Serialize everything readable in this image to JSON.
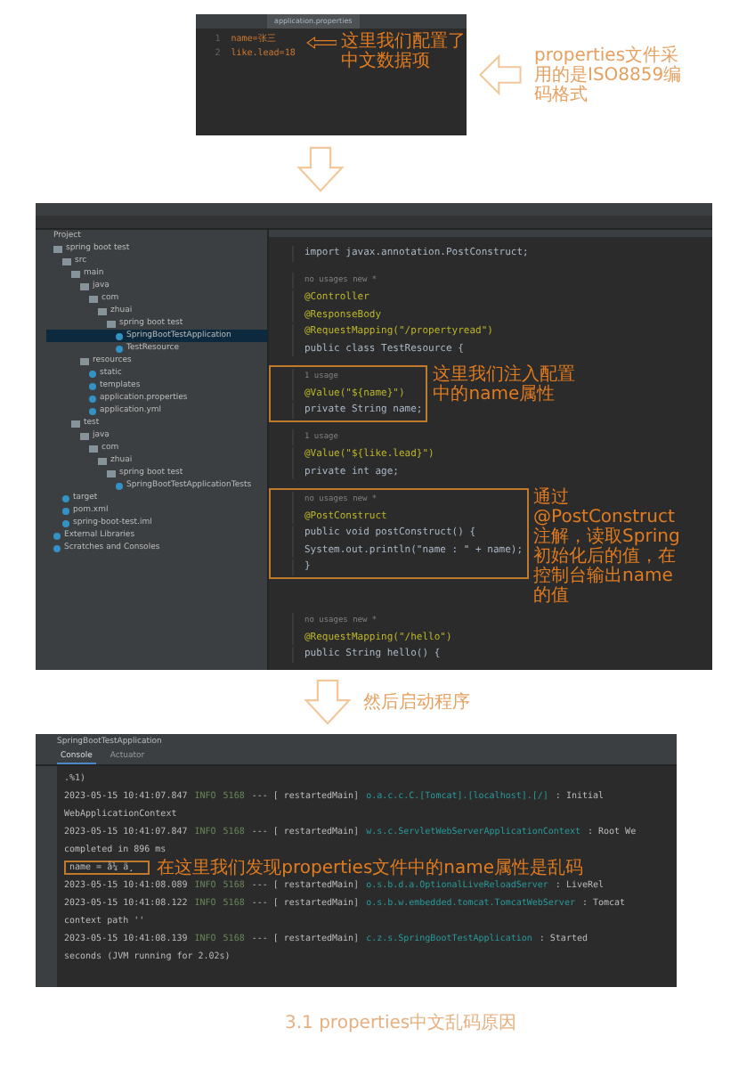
{
  "properties_editor": {
    "tab": "application.properties",
    "lines": [
      {
        "number": "1",
        "text": "name=张三"
      },
      {
        "number": "2",
        "text": "like.lead=18"
      }
    ],
    "note": "这里我们配置了中文数据项",
    "side_note": "properties文件采用的是ISO8859编码格式"
  },
  "ide": {
    "project_title": "Project",
    "project_tree": [
      {
        "label": "spring boot test",
        "selected": false,
        "children": [
          {
            "label": "src",
            "selected": false,
            "children": [
              {
                "label": "main",
                "selected": false,
                "children": [
                  {
                    "label": "java",
                    "selected": false,
                    "children": [
                      {
                        "label": "com",
                        "selected": false,
                        "children": [
                          {
                            "label": "zhuai",
                            "selected": false,
                            "children": [
                              {
                                "label": "spring boot test",
                                "selected": false,
                                "children": [
                                  {
                                    "label": "SpringBootTestApplication",
                                    "selected": true
                                  },
                                  {
                                    "label": "TestResource",
                                    "selected": false
                                  }
                                ]
                              }
                            ]
                          }
                        ]
                      }
                    ]
                  },
                  {
                    "label": "resources",
                    "selected": false,
                    "children": [
                      {
                        "label": "static",
                        "selected": false
                      },
                      {
                        "label": "templates",
                        "selected": false
                      },
                      {
                        "label": "application.properties",
                        "selected": false
                      },
                      {
                        "label": "application.yml",
                        "selected": false
                      }
                    ]
                  }
                ]
              },
              {
                "label": "test",
                "selected": false,
                "children": [
                  {
                    "label": "java",
                    "selected": false,
                    "children": [
                      {
                        "label": "com",
                        "selected": false,
                        "children": [
                          {
                            "label": "zhuai",
                            "selected": false,
                            "children": [
                              {
                                "label": "spring boot test",
                                "selected": false,
                                "children": [
                                  {
                                    "label": "SpringBootTestApplicationTests",
                                    "selected": false
                                  }
                                ]
                              }
                            ]
                          }
                        ]
                      }
                    ]
                  }
                ]
              }
            ]
          },
          {
            "label": "target",
            "selected": false
          },
          {
            "label": "pom.xml",
            "selected": false
          },
          {
            "label": "spring-boot-test.iml",
            "selected": false
          }
        ]
      },
      {
        "label": "External Libraries",
        "selected": false
      },
      {
        "label": "Scratches and Consoles",
        "selected": false
      }
    ],
    "code_blocks": [
      {
        "boxed": false,
        "lines": [
          {
            "kind": "code",
            "text": "import javax.annotation.PostConstruct;"
          }
        ]
      },
      {
        "boxed": false,
        "lines": [
          {
            "kind": "comment",
            "text": "no usages  new *"
          },
          {
            "kind": "annotation",
            "text": "@Controller"
          },
          {
            "kind": "annotation",
            "text": "@ResponseBody"
          },
          {
            "kind": "annotation",
            "text": "@RequestMapping(\"/propertyread\")"
          },
          {
            "kind": "code",
            "text": "public class TestResource {"
          }
        ]
      },
      {
        "boxed": true,
        "note": "这里我们注入配置中的name属性",
        "lines": [
          {
            "kind": "comment",
            "text": "1 usage"
          },
          {
            "kind": "annotation",
            "text": "@Value(\"${name}\")"
          },
          {
            "kind": "code",
            "text": "private String name;"
          }
        ]
      },
      {
        "boxed": false,
        "lines": [
          {
            "kind": "comment",
            "text": "1 usage"
          },
          {
            "kind": "annotation",
            "text": "@Value(\"${like.lead}\")"
          },
          {
            "kind": "code",
            "text": "private int age;"
          }
        ]
      },
      {
        "boxed": true,
        "note": "通过@PostConstruct注解，读取Spring初始化后的值，在控制台输出name的值",
        "lines": [
          {
            "kind": "comment",
            "text": "no usages  new *"
          },
          {
            "kind": "annotation",
            "text": "@PostConstruct"
          },
          {
            "kind": "code",
            "text": "public void postConstruct() {"
          },
          {
            "kind": "code",
            "text": "    System.out.println(\"name : \" + name);"
          },
          {
            "kind": "code",
            "text": "}"
          }
        ]
      },
      {
        "boxed": false,
        "lines": [
          {
            "kind": "comment",
            "text": "no usages  new *"
          },
          {
            "kind": "annotation",
            "text": "@RequestMapping(\"/hello\")"
          },
          {
            "kind": "code",
            "text": "public String hello() {"
          }
        ]
      }
    ]
  },
  "step_note": "然后启动程序",
  "console": {
    "run_tab": "SpringBootTestApplication",
    "tabs": [
      {
        "label": "Console",
        "selected": true
      },
      {
        "label": "Actuator",
        "selected": false
      }
    ],
    "lines": [
      {
        "kind": "text",
        "text": " .%1)"
      },
      {
        "kind": "log",
        "time": "2023-05-15 10:41:07.847",
        "level": "INFO",
        "pid": "5168",
        "thread": "---  [  restartedMain]",
        "logger": "o.a.c.c.C.[Tomcat].[localhost].[/]",
        "message": ": Initial"
      },
      {
        "kind": "text",
        "text": "  WebApplicationContext"
      },
      {
        "kind": "log",
        "time": "2023-05-15 10:41:07.847",
        "level": "INFO",
        "pid": "5168",
        "thread": "---  [  restartedMain]",
        "logger": "w.s.c.ServletWebServerApplicationContext",
        "message": ": Root We"
      },
      {
        "kind": "text",
        "text": "  completed in 896 ms"
      },
      {
        "kind": "boxed",
        "text": "name = å¼ ä¸ ",
        "note": "在这里我们发现properties文件中的name属性是乱码"
      },
      {
        "kind": "log",
        "time": "2023-05-15 10:41:08.089",
        "level": "INFO",
        "pid": "5168",
        "thread": "---  [  restartedMain]",
        "logger": "o.s.b.d.a.OptionalLiveReloadServer",
        "message": ": LiveRel"
      },
      {
        "kind": "log",
        "time": "2023-05-15 10:41:08.122",
        "level": "INFO",
        "pid": "5168",
        "thread": "---  [  restartedMain]",
        "logger": "o.s.b.w.embedded.tomcat.TomcatWebServer",
        "message": ": Tomcat"
      },
      {
        "kind": "text",
        "text": "  context path ''"
      },
      {
        "kind": "log",
        "time": "2023-05-15 10:41:08.139",
        "level": "INFO",
        "pid": "5168",
        "thread": "---  [  restartedMain]",
        "logger": "c.z.s.SpringBootTestApplication",
        "message": ": Started"
      },
      {
        "kind": "text",
        "text": "  seconds (JVM running for 2.02s)"
      }
    ]
  },
  "caption": "3.1 properties中文乱码原因"
}
